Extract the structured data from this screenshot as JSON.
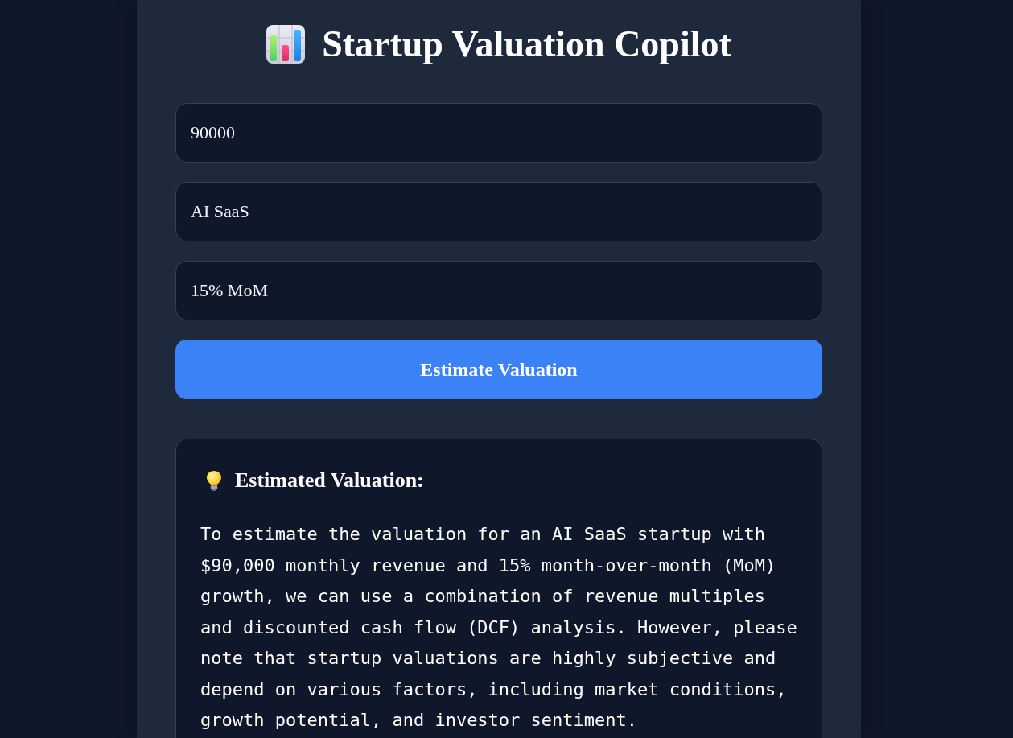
{
  "header": {
    "title": "Startup Valuation Copilot"
  },
  "form": {
    "fields": [
      {
        "value": "90000"
      },
      {
        "value": "AI SaaS"
      },
      {
        "value": "15% MoM"
      }
    ],
    "submit_button": {
      "label": "Estimate Valuation"
    }
  },
  "result": {
    "heading": "Estimated Valuation:",
    "text": "To estimate the valuation for an AI SaaS startup with $90,000 monthly revenue and 15% month-over-month (MoM) growth, we can use a combination of revenue multiples and discounted cash flow (DCF) analysis. However, please note that startup valuations are highly subjective and depend on various factors, including market conditions, growth potential, and investor sentiment."
  }
}
